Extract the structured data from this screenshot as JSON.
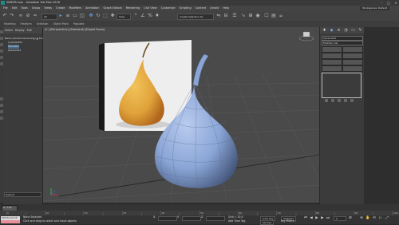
{
  "app": {
    "title": "SM6FM.max - Autodesk 3ds Max 2018",
    "window_controls": [
      "–",
      "□",
      "×"
    ],
    "workspace_label": "Workspaces: Default"
  },
  "menu": [
    "File",
    "Edit",
    "Tools",
    "Group",
    "Views",
    "Create",
    "Modifiers",
    "Animation",
    "Graph Editors",
    "Rendering",
    "Civil View",
    "Customize",
    "Scripting",
    "Content",
    "Arnold",
    "Help"
  ],
  "toolbar": {
    "selection_filter": "All",
    "view_dropdown": "View",
    "selection_set": "Create Selection Se",
    "icons": [
      "undo-icon",
      "redo-icon",
      "link-icon",
      "unlink-icon",
      "bind-icon",
      "filter-icon",
      "select-icon",
      "select-by-name-icon",
      "rect-select-icon",
      "window-crossing-icon",
      "move-icon",
      "rotate-icon",
      "scale-icon",
      "pivot-icon",
      "snap-icon",
      "angle-snap-icon",
      "percent-snap-icon",
      "spinner-snap-icon",
      "mirror-icon",
      "align-icon",
      "layer-icon",
      "curve-editor-icon",
      "schematic-icon",
      "material-icon",
      "render-setup-icon",
      "render-frame-icon",
      "render-icon"
    ],
    "colors": {
      "accent": "#6aa6e8"
    }
  },
  "ribbon": [
    "Modeling",
    "Freeform",
    "Selection",
    "Object Paint",
    "Populate"
  ],
  "explorer": {
    "tabs": [
      "Select",
      "Display",
      "Edit"
    ],
    "rows": [
      {
        "label": "Name (Sorted Ascending)   ▲ Froz",
        "selected": false
      },
      {
        "label": "Cylinder001",
        "selected": false
      },
      {
        "label": "Plane001",
        "selected": true
      },
      {
        "label": "Sphere001",
        "selected": false
      }
    ],
    "footer": "Default"
  },
  "viewport": {
    "label": "[+] [Perspective] [Standard] [Edged Faces]",
    "background": "#4a4a4a",
    "pear_color": "#8aa5d6",
    "photo_pear_color": "#e0a23a"
  },
  "command_panel": {
    "tabs": [
      "create-icon",
      "modify-icon",
      "hierarchy-icon",
      "motion-icon",
      "display-icon",
      "utilities-icon"
    ],
    "object_name": "Sphere001",
    "modifier_list": "Modifier List"
  },
  "timeline": {
    "position": "0 / 100",
    "ticks": [
      "0",
      "10",
      "20",
      "30",
      "40",
      "50",
      "60",
      "70",
      "80",
      "90",
      "100"
    ]
  },
  "status": {
    "maxscript": "MAXScript Mi",
    "line1": "None Selected",
    "line2": "Click and drag to select and move objects",
    "x_label": "X:",
    "y_label": "Y:",
    "z_label": "Z:",
    "grid": "Grid = 10.0",
    "add_time_tag": "Add Time Tag",
    "auto_key": "Auto Key",
    "set_key": "Set Key",
    "selected": "Selected",
    "key_filters": "Key Filters...",
    "frame": "0"
  }
}
